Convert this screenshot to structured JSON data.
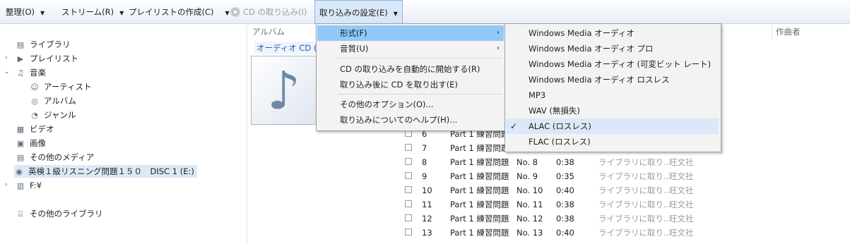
{
  "toolbar": {
    "organize": "整理(O)",
    "stream": "ストリーム(R)",
    "create_playlist": "プレイリストの作成(C)",
    "rip_cd": "CD の取り込み(I)",
    "rip_settings": "取り込みの設定(E)"
  },
  "nav": {
    "library": "ライブラリ",
    "playlists": "プレイリスト",
    "music": "音楽",
    "artist": "アーティスト",
    "album": "アルバム",
    "genre": "ジャンル",
    "video": "ビデオ",
    "pictures": "画像",
    "other_media": "その他のメディア",
    "disc": "英検１級リスニング問題１５０　DISC 1 (E:)",
    "drive_f": "F:¥",
    "other_libraries": "その他のライブラリ"
  },
  "content": {
    "col_album": "アルバム",
    "col_composer": "作曲者",
    "cd_title": "オーディオ CD (E:)",
    "rows": [
      {
        "num": "6",
        "title": "Part 1 練習問題",
        "no": "",
        "len": "",
        "status": "",
        "contrib": ""
      },
      {
        "num": "7",
        "title": "Part 1 練習問題",
        "no": "",
        "len": "",
        "status": "",
        "contrib": ""
      },
      {
        "num": "8",
        "title": "Part 1 練習問題",
        "no": "No. 8",
        "len": "0:38",
        "status": "ライブラリに取り...",
        "contrib": "旺文社"
      },
      {
        "num": "9",
        "title": "Part 1 練習問題",
        "no": "No. 9",
        "len": "0:35",
        "status": "ライブラリに取り...",
        "contrib": "旺文社"
      },
      {
        "num": "10",
        "title": "Part 1 練習問題",
        "no": "No. 10",
        "len": "0:40",
        "status": "ライブラリに取り...",
        "contrib": "旺文社"
      },
      {
        "num": "11",
        "title": "Part 1 練習問題",
        "no": "No. 11",
        "len": "0:38",
        "status": "ライブラリに取り...",
        "contrib": "旺文社"
      },
      {
        "num": "12",
        "title": "Part 1 練習問題",
        "no": "No. 12",
        "len": "0:38",
        "status": "ライブラリに取り...",
        "contrib": "旺文社"
      },
      {
        "num": "13",
        "title": "Part 1 練習問題",
        "no": "No. 13",
        "len": "0:40",
        "status": "ライブラリに取り...",
        "contrib": "旺文社"
      }
    ]
  },
  "menu": {
    "format": "形式(F)",
    "quality": "音質(U)",
    "auto_rip": "CD の取り込みを自動的に開始する(R)",
    "eject_after": "取り込み後に CD を取り出す(E)",
    "more_options": "その他のオプション(O)...",
    "help": "取り込みについてのヘルプ(H)..."
  },
  "format_menu": {
    "items": [
      "Windows Media オーディオ",
      "Windows Media オーディオ プロ",
      "Windows Media オーディオ (可変ビット レート)",
      "Windows Media オーディオ ロスレス",
      "MP3",
      "WAV (無損失)",
      "ALAC (ロスレス)",
      "FLAC (ロスレス)"
    ],
    "selected": "ALAC (ロスレス)",
    "check": "✓"
  }
}
